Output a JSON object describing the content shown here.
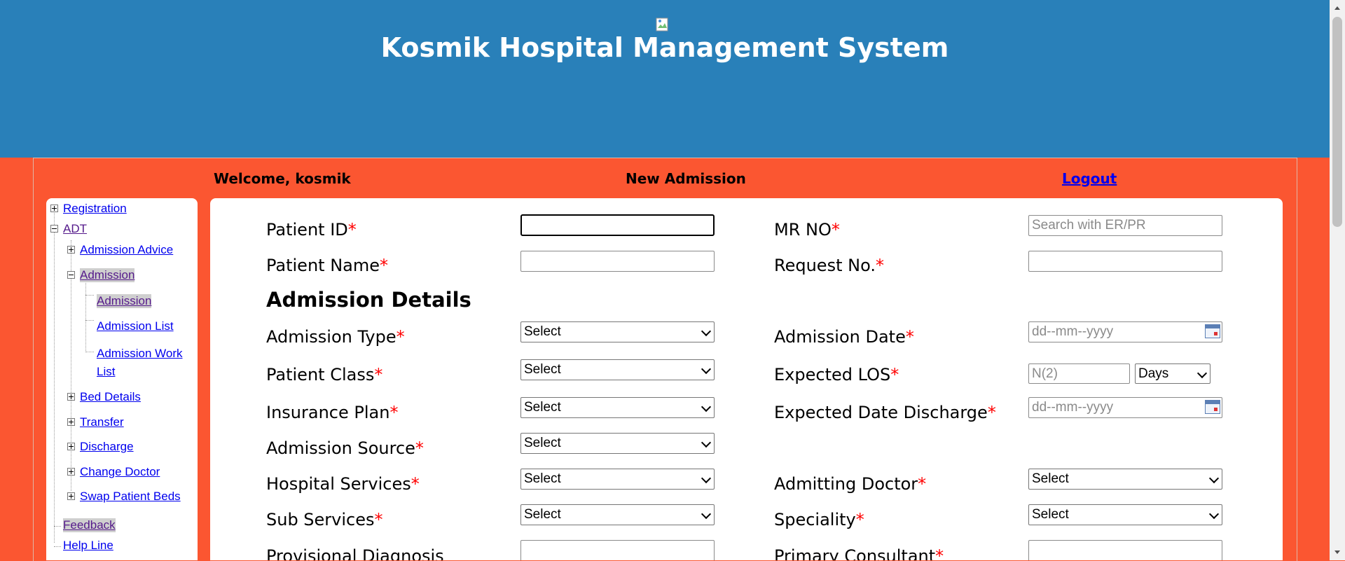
{
  "header": {
    "title": "Kosmik Hospital Management System",
    "logo_icon": "broken-image-icon"
  },
  "topbar": {
    "welcome": "Welcome, kosmik",
    "page_heading": "New Admission",
    "logout": "Logout"
  },
  "sidebar": {
    "registration": "Registration",
    "adt": "ADT",
    "admission_advice": "Admission Advice",
    "admission": "Admission",
    "admission_sub": "Admission",
    "admission_list": "Admission List",
    "admission_work_list_line1": "Admission Work",
    "admission_work_list_line2": "List",
    "bed_details": "Bed Details",
    "transfer": "Transfer",
    "discharge": "Discharge",
    "change_doctor": "Change Doctor",
    "swap_patient_beds": "Swap Patient Beds",
    "feedback": "Feedback",
    "help_line": "Help Line"
  },
  "form": {
    "required_marker": "*",
    "patient_id": {
      "label": "Patient ID",
      "value": ""
    },
    "mr_no": {
      "label": "MR NO",
      "placeholder": "Search with ER/PR"
    },
    "patient_name": {
      "label": "Patient Name",
      "value": ""
    },
    "request_no": {
      "label": "Request No.",
      "value": ""
    },
    "section_title": "Admission Details",
    "admission_type": {
      "label": "Admission Type",
      "selected": "Select"
    },
    "admission_date": {
      "label": "Admission Date",
      "placeholder": "dd--mm--yyyy"
    },
    "patient_class": {
      "label": "Patient Class",
      "selected": "Select"
    },
    "expected_los": {
      "label": "Expected LOS",
      "placeholder": "N(2)",
      "unit_selected": "Days"
    },
    "insurance_plan": {
      "label": "Insurance Plan",
      "selected": "Select"
    },
    "expected_date_discharge": {
      "label": "Expected Date Discharge",
      "placeholder": "dd--mm--yyyy"
    },
    "admission_source": {
      "label": "Admission Source",
      "selected": "Select"
    },
    "hospital_services": {
      "label": "Hospital Services",
      "selected": "Select"
    },
    "admitting_doctor": {
      "label": "Admitting Doctor",
      "selected": "Select"
    },
    "sub_services": {
      "label": "Sub Services",
      "selected": "Select"
    },
    "speciality": {
      "label": "Speciality",
      "selected": "Select"
    },
    "provisional_diagnosis": {
      "label": "Provisional Diagnosis",
      "value": ""
    },
    "primary_consultant": {
      "label": "Primary Consultant",
      "value": ""
    }
  },
  "colors": {
    "banner": "#2980b9",
    "background": "#fb5631",
    "required": "#ff0000",
    "link": "#0000ee"
  }
}
